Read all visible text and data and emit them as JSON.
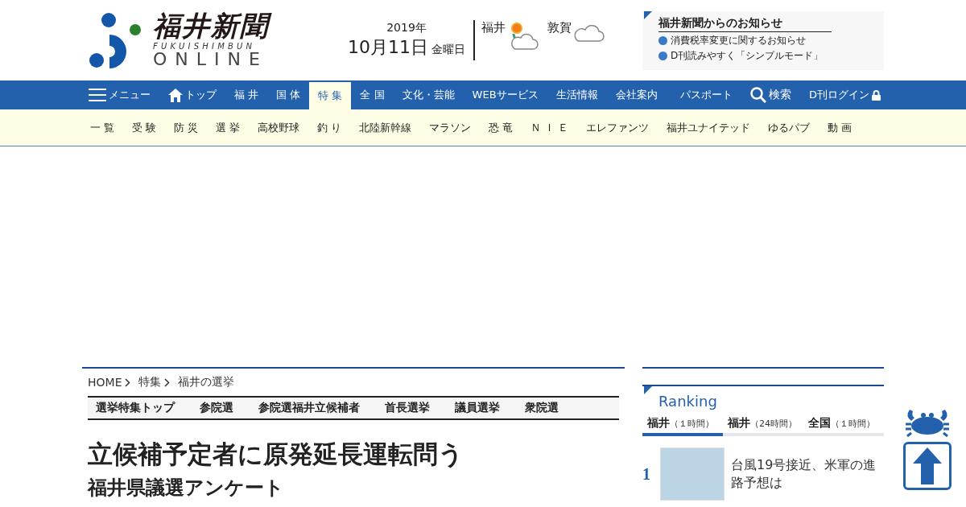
{
  "logo": {
    "title": "福井新聞",
    "romaji": "FUKUISHIMBUN",
    "online": "ONLINE"
  },
  "date": {
    "year": "2019年",
    "day": "10月11日",
    "weekday": "金曜日"
  },
  "weather": [
    {
      "city": "福井",
      "kind": "sun_cloud"
    },
    {
      "city": "敦賀",
      "kind": "cloud"
    }
  ],
  "notice": {
    "title": "福井新聞からのお知らせ",
    "items": [
      "消費税率変更に関するお知らせ",
      "D刊読みやすく「シンプルモード」"
    ]
  },
  "nav": {
    "menu": "メニュー",
    "items": [
      {
        "label": "トップ",
        "kind": "home",
        "selected": false
      },
      {
        "label": "福 井",
        "kind": "text",
        "selected": false
      },
      {
        "label": "国 体",
        "kind": "text",
        "selected": false
      },
      {
        "label": "特 集",
        "kind": "text",
        "selected": true
      },
      {
        "label": "全 国",
        "kind": "text",
        "selected": false
      },
      {
        "label": "文化・芸能",
        "kind": "text",
        "selected": false
      },
      {
        "label": "WEBサービス",
        "kind": "text",
        "selected": false
      },
      {
        "label": "生活情報",
        "kind": "text",
        "selected": false
      },
      {
        "label": "会社案内",
        "kind": "text",
        "selected": false
      }
    ],
    "passport": "パスポート",
    "search": "検索",
    "login": "D刊ログイン"
  },
  "subnav": [
    "一 覧",
    "受 験",
    "防 災",
    "選 挙",
    "高校野球",
    "釣 り",
    "北陸新幹線",
    "マラソン",
    "恐 竜",
    "Ｎ Ｉ Ｅ",
    "エレファンツ",
    "福井ユナイテッド",
    "ゆるパブ",
    "動 画"
  ],
  "breadcrumb": [
    "HOME",
    "特集",
    "福井の選挙"
  ],
  "election_tabs": [
    "選挙特集トップ",
    "参院選",
    "参院選福井立候補者",
    "首長選挙",
    "議員選挙",
    "衆院選"
  ],
  "article": {
    "title": "立候補予定者に原発延長運転問う",
    "subtitle": "福井県議選アンケート"
  },
  "ranking": {
    "title": "Ranking",
    "tabs": [
      {
        "label": "福井",
        "period": "（１時間）",
        "selected": true
      },
      {
        "label": "福井",
        "period": "（24時間）",
        "selected": false
      },
      {
        "label": "全国",
        "period": "（１時間）",
        "selected": false
      }
    ],
    "items": [
      {
        "rank": "1",
        "headline": "台風19号接近、米軍の進路予想は"
      }
    ]
  }
}
